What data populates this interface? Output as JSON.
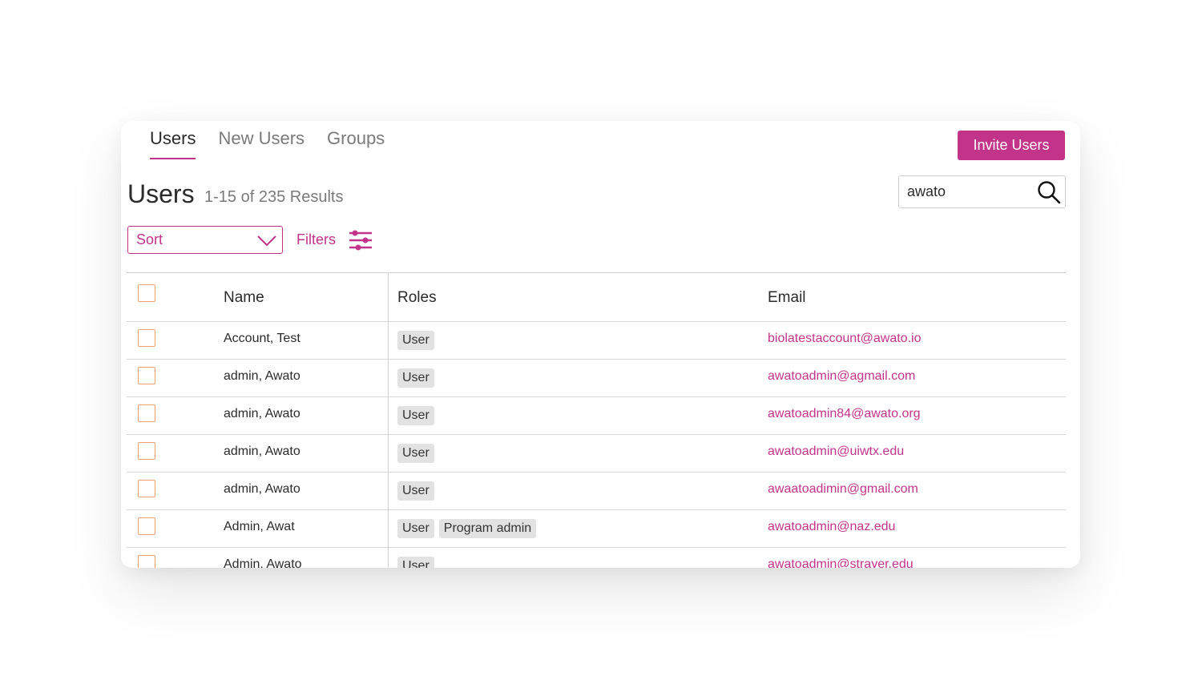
{
  "tabs": [
    {
      "label": "Users",
      "active": true
    },
    {
      "label": "New Users",
      "active": false
    },
    {
      "label": "Groups",
      "active": false
    }
  ],
  "invite_button": "Invite Users",
  "page_title": "Users",
  "results_text": "1-15 of 235 Results",
  "search": {
    "value": "awato",
    "icon": "search-icon"
  },
  "sort": {
    "label": "Sort",
    "icon": "chevron-down-icon"
  },
  "filters": {
    "label": "Filters",
    "icon": "sliders-icon"
  },
  "table": {
    "headers": {
      "name": "Name",
      "roles": "Roles",
      "email": "Email"
    },
    "rows": [
      {
        "name": "Account, Test",
        "roles": [
          "User"
        ],
        "email": "biolatestaccount@awato.io"
      },
      {
        "name": "admin, Awato",
        "roles": [
          "User"
        ],
        "email": "awatoadmin@agmail.com"
      },
      {
        "name": "admin, Awato",
        "roles": [
          "User"
        ],
        "email": "awatoadmin84@awato.org"
      },
      {
        "name": "admin, Awato",
        "roles": [
          "User"
        ],
        "email": "awatoadmin@uiwtx.edu"
      },
      {
        "name": "admin, Awato",
        "roles": [
          "User"
        ],
        "email": "awaatoadimin@gmail.com"
      },
      {
        "name": "Admin, Awat",
        "roles": [
          "User",
          "Program admin"
        ],
        "email": "awatoadmin@naz.edu"
      },
      {
        "name": "Admin, Awato",
        "roles": [
          "User"
        ],
        "email": "awatoadmin@strayer.edu"
      }
    ]
  },
  "colors": {
    "accent": "#c2338a",
    "checkbox_border": "#f0a070",
    "badge_bg": "#e2e2e2"
  }
}
